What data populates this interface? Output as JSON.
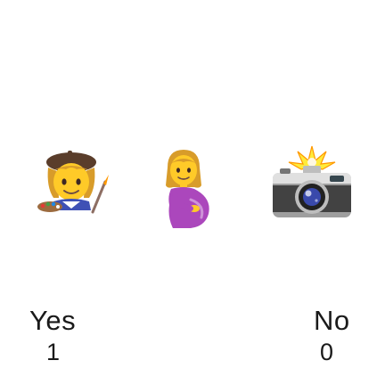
{
  "emojis": [
    {
      "icon": "woman-artist-icon"
    },
    {
      "icon": "pregnant-woman-icon"
    },
    {
      "icon": "camera-with-flash-icon"
    }
  ],
  "answers": {
    "yes": {
      "label": "Yes",
      "count": "1"
    },
    "no": {
      "label": "No",
      "count": "0"
    }
  }
}
